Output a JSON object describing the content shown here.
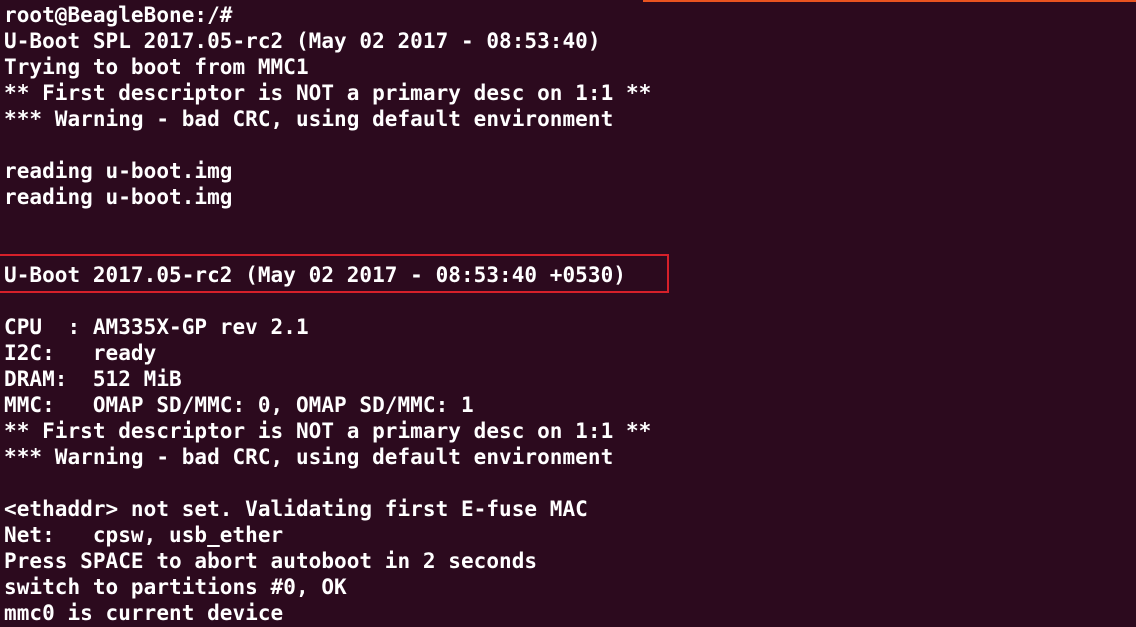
{
  "terminal": {
    "lines": [
      "root@BeagleBone:/#",
      "U-Boot SPL 2017.05-rc2 (May 02 2017 - 08:53:40)",
      "Trying to boot from MMC1",
      "** First descriptor is NOT a primary desc on 1:1 **",
      "*** Warning - bad CRC, using default environment",
      "",
      "reading u-boot.img",
      "reading u-boot.img",
      "",
      "",
      "U-Boot 2017.05-rc2 (May 02 2017 - 08:53:40 +0530)",
      "",
      "CPU  : AM335X-GP rev 2.1",
      "I2C:   ready",
      "DRAM:  512 MiB",
      "MMC:   OMAP SD/MMC: 0, OMAP SD/MMC: 1",
      "** First descriptor is NOT a primary desc on 1:1 **",
      "*** Warning - bad CRC, using default environment",
      "",
      "<ethaddr> not set. Validating first E-fuse MAC",
      "Net:   cpsw, usb_ether",
      "Press SPACE to abort autoboot in 2 seconds",
      "switch to partitions #0, OK",
      "mmc0 is current device"
    ]
  },
  "colors": {
    "background": "#2c0a1e",
    "text": "#ffffff",
    "highlight_border": "#d6202a",
    "top_accent": "#e95420"
  }
}
